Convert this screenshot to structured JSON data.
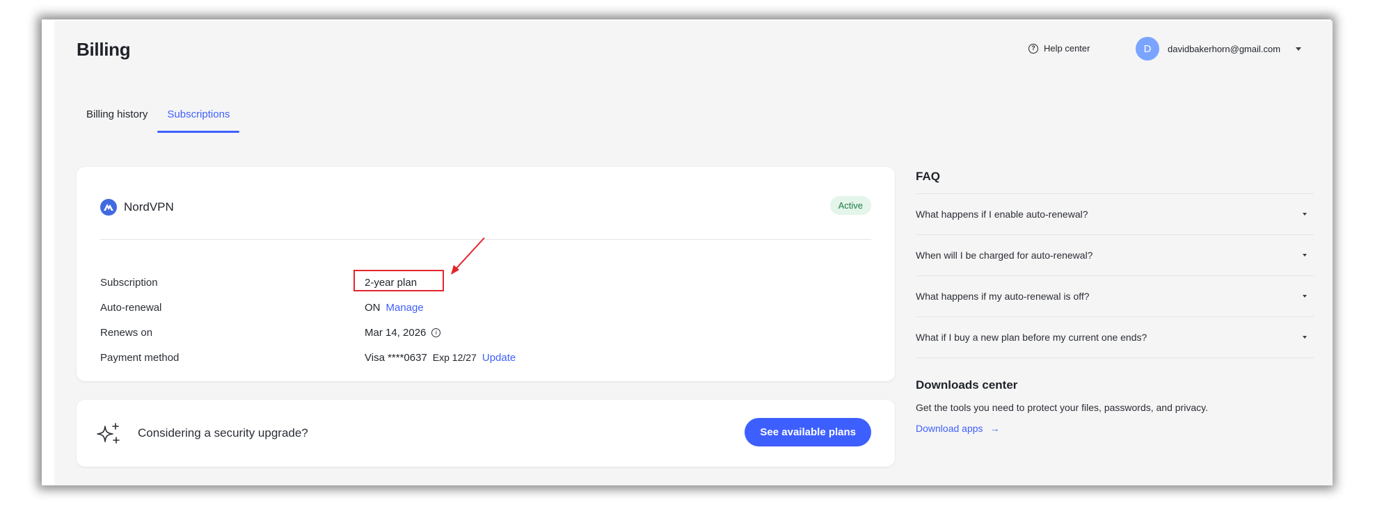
{
  "header": {
    "title": "Billing",
    "help_label": "Help center",
    "user_initial": "D",
    "user_email": "davidbakerhorn@gmail.com"
  },
  "tabs": [
    {
      "label": "Billing history",
      "active": false
    },
    {
      "label": "Subscriptions",
      "active": true
    }
  ],
  "subscription": {
    "product": "NordVPN",
    "status": "Active",
    "rows": [
      {
        "label": "Subscription",
        "value": "2-year plan"
      },
      {
        "label": "Auto-renewal",
        "value": "ON",
        "action": "Manage"
      },
      {
        "label": "Renews on",
        "value": "Mar 14, 2026"
      },
      {
        "label": "Payment method",
        "value": "Visa ****0637",
        "extra": "Exp 12/27",
        "action": "Update"
      }
    ]
  },
  "upgrade": {
    "text": "Considering a security upgrade?",
    "button": "See available plans"
  },
  "faq": {
    "title": "FAQ",
    "items": [
      "What happens if I enable auto-renewal?",
      "When will I be charged for auto-renewal?",
      "What happens if my auto-renewal is off?",
      "What if I buy a new plan before my current one ends?"
    ]
  },
  "downloads": {
    "title": "Downloads center",
    "description": "Get the tools you need to protect your files, passwords, and privacy.",
    "link": "Download apps"
  },
  "colors": {
    "accent": "#3e5fff",
    "annotation": "#e3242b",
    "active_badge_bg": "#e4f5ea",
    "active_badge_text": "#1e7a45"
  }
}
